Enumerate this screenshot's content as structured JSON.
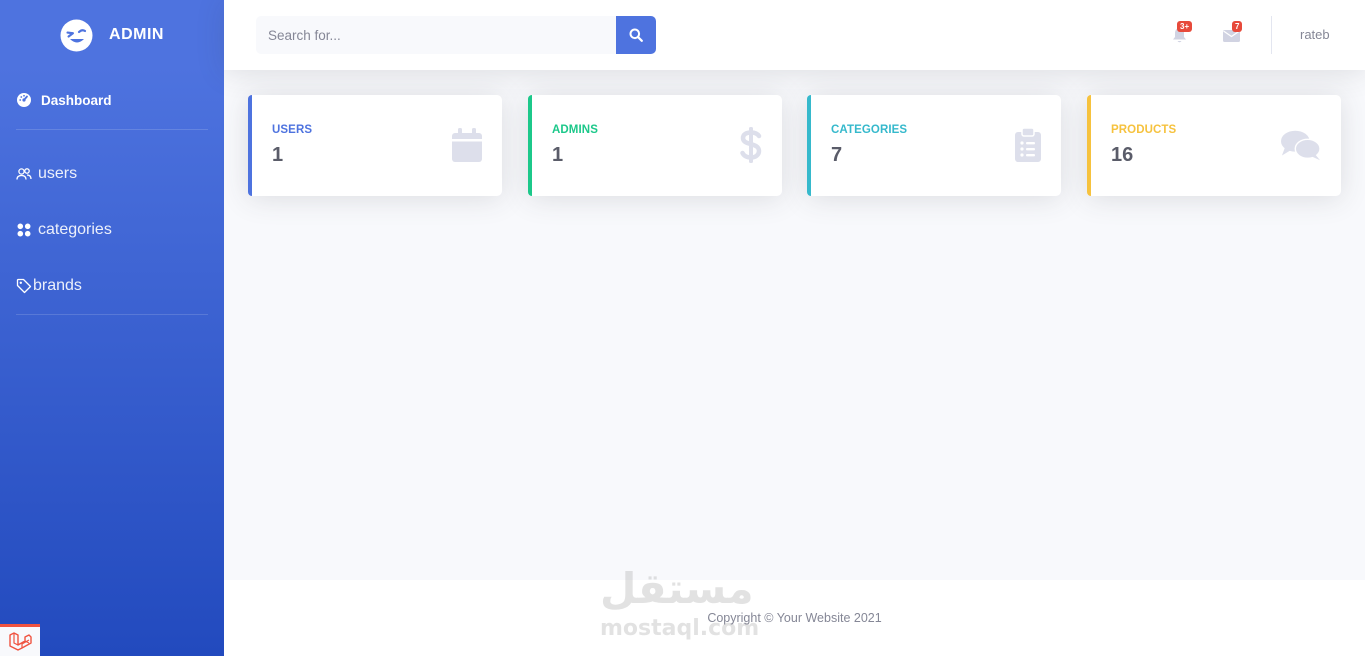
{
  "sidebar": {
    "brand": {
      "name": "ADMIN",
      "icon": "laughing-face-icon"
    },
    "items": [
      {
        "label": "Dashboard",
        "icon": "tachometer-icon",
        "active": true
      },
      {
        "label": "users",
        "icon": "users-icon"
      },
      {
        "label": "categories",
        "icon": "grid-icon"
      },
      {
        "label": "brands",
        "icon": "tag-icon"
      }
    ],
    "footer_badge": {
      "icon": "laravel-logo-icon"
    }
  },
  "topbar": {
    "search": {
      "placeholder": "Search for...",
      "button_icon": "search-icon"
    },
    "alerts": {
      "icon": "bell-icon",
      "count": "3+"
    },
    "messages": {
      "icon": "envelope-icon",
      "count": "7"
    },
    "user": {
      "name": "rateb"
    }
  },
  "cards": [
    {
      "label": "USERS",
      "value": "1",
      "icon": "calendar-icon",
      "accent": "#4e73df"
    },
    {
      "label": "ADMINS",
      "value": "1",
      "icon": "dollar-icon",
      "accent": "#1cc88a"
    },
    {
      "label": "CATEGORIES",
      "value": "7",
      "icon": "clipboard-list-icon",
      "accent": "#36b9cc"
    },
    {
      "label": "PRODUCTS",
      "value": "16",
      "icon": "comments-icon",
      "accent": "#f6c23e"
    }
  ],
  "footer": {
    "copyright": "Copyright © Your Website 2021",
    "watermark": {
      "arabic": "مستقل",
      "latin": "mostaql.com"
    }
  },
  "colors": {
    "primary": "#4e73df",
    "success": "#1cc88a",
    "info": "#36b9cc",
    "warning": "#f6c23e",
    "danger": "#e74a3b",
    "background": "#f8f9fc"
  }
}
